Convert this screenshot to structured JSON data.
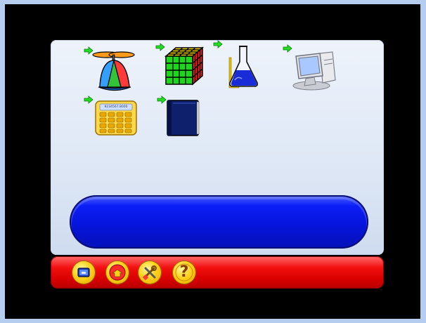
{
  "activities": [
    {
      "name": "propeller-hat-icon"
    },
    {
      "name": "rubiks-cube-icon"
    },
    {
      "name": "chemistry-flask-icon"
    },
    {
      "name": "computer-icon"
    },
    {
      "name": "calculator-icon"
    },
    {
      "name": "book-icon"
    }
  ],
  "calculator": {
    "display": "9234567.8000"
  },
  "status": {
    "text": ""
  },
  "toolbar": {
    "buttons": [
      {
        "name": "screen-toggle-icon"
      },
      {
        "name": "leave-icon"
      },
      {
        "name": "tools-icon"
      },
      {
        "name": "help-icon"
      }
    ],
    "help_symbol": "?"
  },
  "colors": {
    "background": "#b5cdee",
    "panel": "#dfe8f6",
    "status_bar": "#0614d8",
    "bottom_bar": "#e00000",
    "button_yellow": "#ffd21a"
  }
}
